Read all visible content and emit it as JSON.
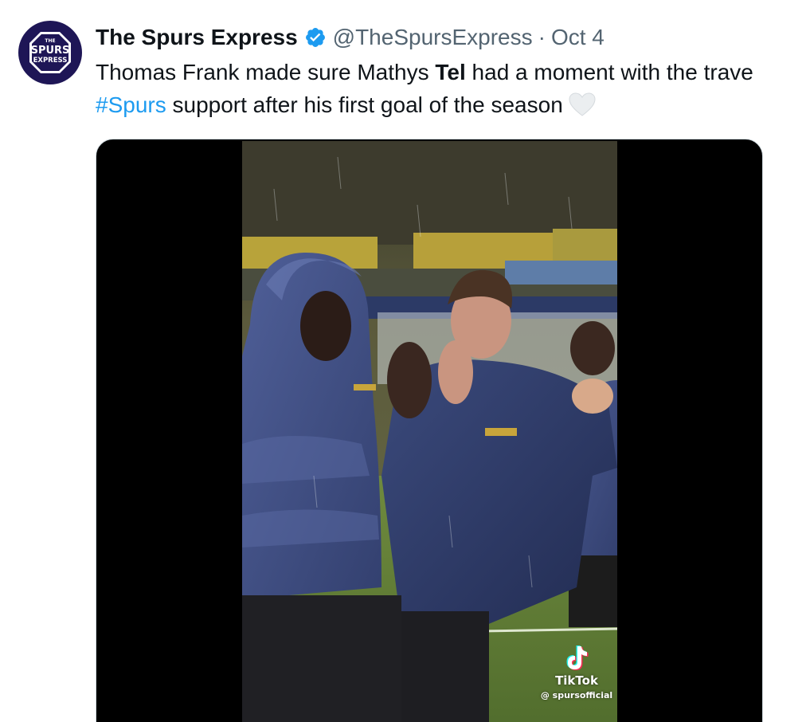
{
  "tweet": {
    "display_name": "The Spurs Express",
    "handle": "@TheSpursExpress",
    "separator": "·",
    "date": "Oct 4",
    "verified": true,
    "avatar": {
      "line1": "THE",
      "line2": "SPURS",
      "line3": "EXPRESS"
    },
    "text": {
      "part1": "Thomas Frank made sure Mathys ",
      "bold": "Tel",
      "part2": " had a moment with the trave",
      "hashtag": "#Spurs",
      "part3": " support after his first goal of the season",
      "emoji_icon": "white-heart-icon"
    },
    "media": {
      "watermark_brand": "TikTok",
      "watermark_user": "@ spursofficial"
    }
  },
  "colors": {
    "accent": "#1d9bf0",
    "avatar_bg": "#1e1656",
    "text": "#0f1419",
    "secondary_text": "#536471",
    "media_bg": "#000000"
  }
}
